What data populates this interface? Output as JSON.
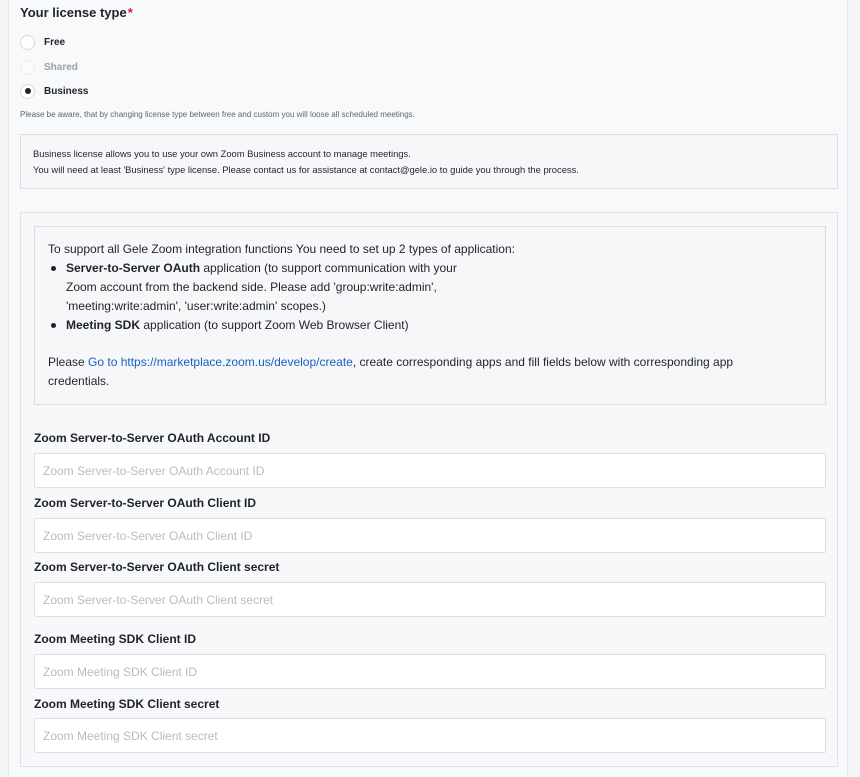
{
  "license": {
    "title": "Your license type",
    "required_mark": "*",
    "options": [
      {
        "label": "Free",
        "selected": false,
        "disabled": false
      },
      {
        "label": "Shared",
        "selected": false,
        "disabled": true
      },
      {
        "label": "Business",
        "selected": true,
        "disabled": false
      }
    ],
    "warning": "Please be aware, that by changing license type between free and custom you will loose all scheduled meetings."
  },
  "business_info": {
    "line1": "Business license allows you to use your own Zoom Business account to manage meetings.",
    "line2": "You will need at least 'Business' type license. Please contact us for assistance at contact@gele.io to guide you through the process."
  },
  "instructions": {
    "intro": "To support all Gele Zoom integration functions You need to set up 2 types of application:",
    "items": [
      {
        "bold": "Server-to-Server OAuth",
        "rest": " application (to support communication with your"
      },
      {
        "bold": "Meeting SDK",
        "rest": " application (to support Zoom Web Browser Client)"
      }
    ],
    "item1_line2": "Zoom account from the backend side. Please add 'group:write:admin',",
    "item1_line3": "'meeting:write:admin', 'user:write:admin' scopes.)",
    "please_prefix": "Please ",
    "link_text": "Go to https://marketplace.zoom.us/develop/create",
    "please_suffix": ", create corresponding apps and fill fields below with corresponding app",
    "please_line2": "credentials."
  },
  "fields": [
    {
      "label": "Zoom Server-to-Server OAuth Account ID",
      "placeholder": "Zoom Server-to-Server OAuth Account ID",
      "value": ""
    },
    {
      "label": "Zoom Server-to-Server OAuth Client ID",
      "placeholder": "Zoom Server-to-Server OAuth Client ID",
      "value": ""
    },
    {
      "label": "Zoom Server-to-Server OAuth Client secret",
      "placeholder": "Zoom Server-to-Server OAuth Client secret",
      "value": ""
    },
    {
      "label": "Zoom Meeting SDK Client ID",
      "placeholder": "Zoom Meeting SDK Client ID",
      "value": ""
    },
    {
      "label": "Zoom Meeting SDK Client secret",
      "placeholder": "Zoom Meeting SDK Client secret",
      "value": ""
    }
  ],
  "colors": {
    "accent_link": "#1b5fc2",
    "required": "#d21f3c",
    "text": "#1f2328"
  }
}
